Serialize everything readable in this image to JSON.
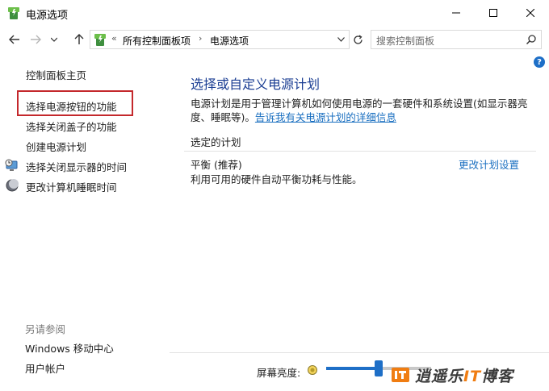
{
  "window": {
    "title": "电源选项"
  },
  "navigation": {
    "breadcrumbs": [
      "所有控制面板项",
      "电源选项"
    ],
    "search_placeholder": "搜索控制面板"
  },
  "sidebar": {
    "home": "控制面板主页",
    "links": [
      "选择电源按钮的功能",
      "选择关闭盖子的功能",
      "创建电源计划",
      "选择关闭显示器的时间",
      "更改计算机睡眠时间"
    ],
    "see_also_label": "另请参阅",
    "see_also": [
      "Windows 移动中心",
      "用户帐户"
    ]
  },
  "main": {
    "title": "选择或自定义电源计划",
    "description_line1": "电源计划是用于管理计算机如何使用电源的一套硬件和系统设置(如显示器亮",
    "description_line2_prefix": "度、睡眠等)。",
    "description_link": "告诉我有关电源计划的详细信息",
    "selected_plan_label": "选定的计划",
    "plan_name": "平衡 (推荐)",
    "plan_description": "利用可用的硬件自动平衡功耗与性能。",
    "change_plan": "更改计划设置"
  },
  "footer": {
    "brightness_label": "屏幕亮度:",
    "brightness_level_percent": 50
  },
  "watermark": {
    "prefix": "逍遥乐",
    "it": "IT",
    "suffix": "博客"
  },
  "colors": {
    "title_blue": "#1b3e93",
    "link_blue": "#1a6fc0",
    "highlight_red": "#c4282c",
    "accent": "#1e6fc7"
  },
  "icons": [
    "power-options-icon",
    "minimize-icon",
    "maximize-icon",
    "close-icon",
    "back-arrow-icon",
    "forward-arrow-icon",
    "recent-dropdown-icon",
    "up-arrow-icon",
    "refresh-icon",
    "search-icon",
    "help-icon",
    "monitor-clock-icon",
    "moon-sleep-icon",
    "brightness-icon"
  ]
}
